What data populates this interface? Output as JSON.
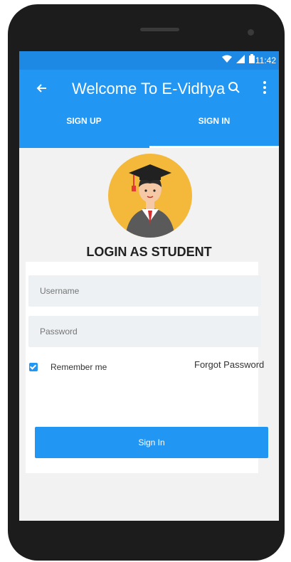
{
  "statusbar": {
    "time": "11:42",
    "icons": [
      "wifi-icon",
      "signal-icon",
      "battery-icon"
    ]
  },
  "appbar": {
    "title": "Welcome To E-Vidhya"
  },
  "tabs": [
    {
      "label": "SIGN UP",
      "active": false
    },
    {
      "label": "SIGN IN",
      "active": true
    }
  ],
  "login": {
    "heading": "LOGIN AS STUDENT",
    "username_placeholder": "Username",
    "password_placeholder": "Password",
    "remember_label": "Remember me",
    "remember_checked": true,
    "forgot_label": "Forgot Password",
    "signin_label": "Sign In"
  },
  "colors": {
    "primary": "#2196f3",
    "statusbar": "#1e88e5",
    "avatar_bg": "#f4b93b"
  }
}
